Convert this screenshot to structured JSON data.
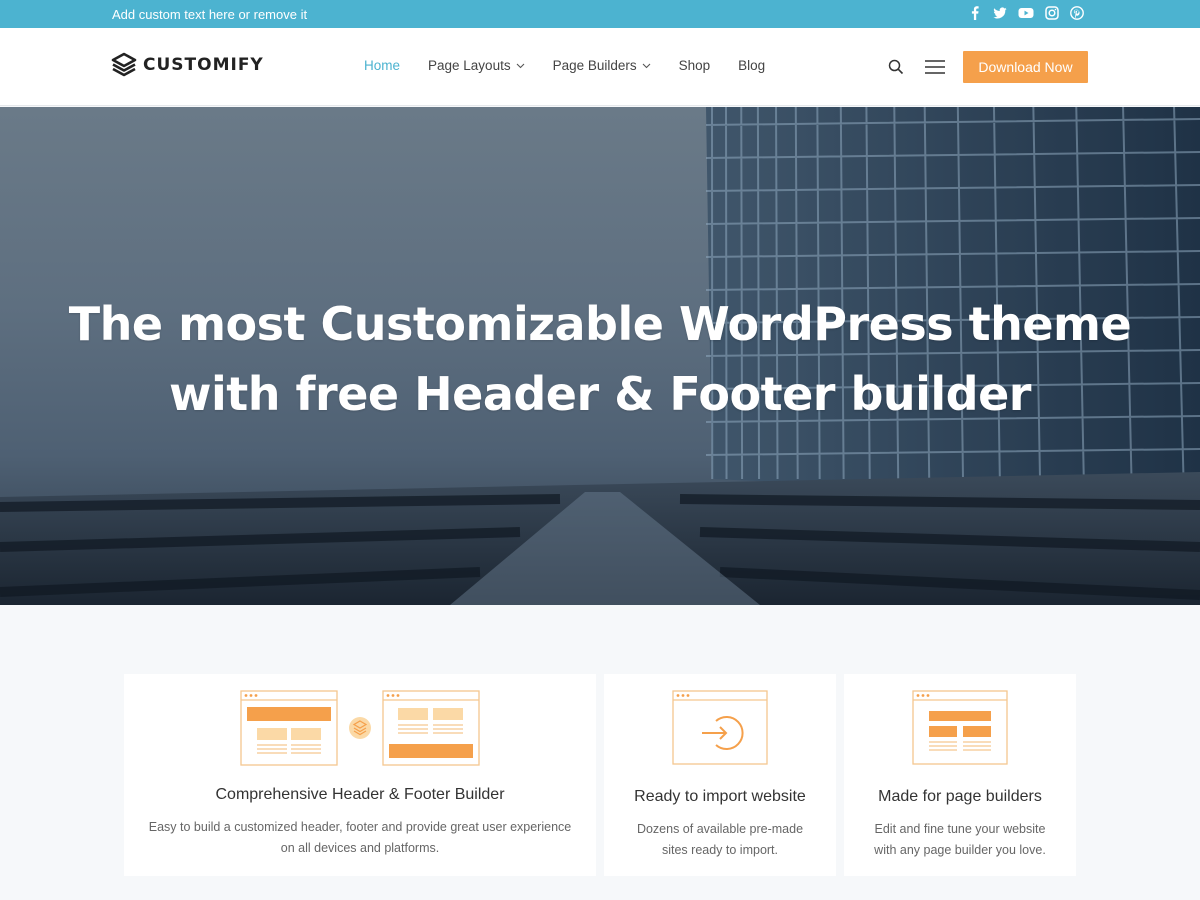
{
  "topbar": {
    "text": "Add custom text here or remove it",
    "social": [
      "facebook-icon",
      "twitter-icon",
      "youtube-icon",
      "instagram-icon",
      "pinterest-icon"
    ]
  },
  "header": {
    "logo_text": "CUSTOMIFY",
    "nav": [
      {
        "label": "Home",
        "active": true,
        "dropdown": false
      },
      {
        "label": "Page Layouts",
        "active": false,
        "dropdown": true
      },
      {
        "label": "Page Builders",
        "active": false,
        "dropdown": true
      },
      {
        "label": "Shop",
        "active": false,
        "dropdown": false
      },
      {
        "label": "Blog",
        "active": false,
        "dropdown": false
      }
    ],
    "cta_label": "Download Now"
  },
  "hero": {
    "title_line1": "The most Customizable WordPress theme",
    "title_line2": "with free Header & Footer builder"
  },
  "features": [
    {
      "title": "Comprehensive Header & Footer Builder",
      "desc_line1": "Easy to build a customized header, footer and provide great user experience",
      "desc_line2": "on all devices and platforms."
    },
    {
      "title": "Ready to import website",
      "desc_line1": "Dozens of available pre-made",
      "desc_line2": "sites ready to import."
    },
    {
      "title": "Made for page builders",
      "desc_line1": "Edit and fine tune your website",
      "desc_line2": "with any page builder you love."
    }
  ],
  "colors": {
    "topbar": "#4cb3d0",
    "accent": "#4cb3d0",
    "cta": "#f5a04b",
    "illustration": "#f5a04b",
    "illustration_light": "#fbd9a6"
  }
}
